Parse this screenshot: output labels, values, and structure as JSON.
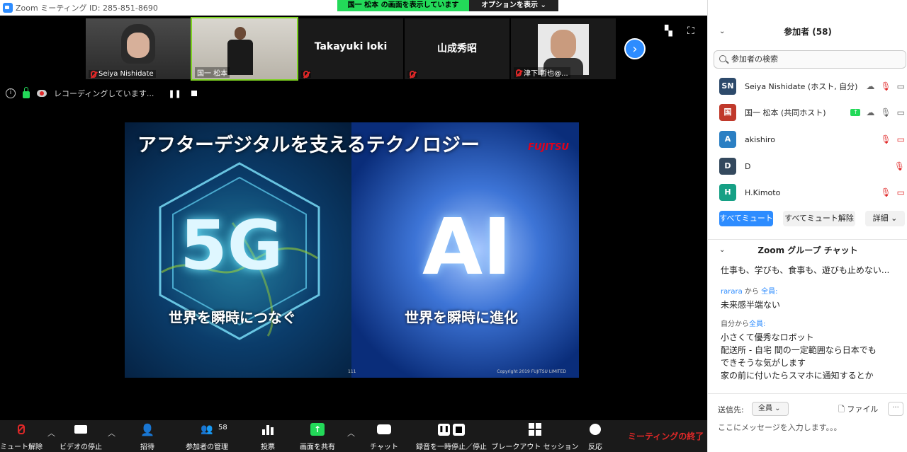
{
  "window": {
    "title": "Zoom ミーティング ID: 285-851-8690"
  },
  "share_banner": "国一 松本 の画面を表示しています",
  "options_button": "オプションを表示",
  "thumbnails": [
    {
      "name": "Seiya Nishidate",
      "video": true,
      "muted": true
    },
    {
      "name": "国一 松本",
      "video": true,
      "muted": false,
      "active": true
    },
    {
      "name": "Takayuki Ioki",
      "video": false,
      "muted": true
    },
    {
      "name": "山成秀昭",
      "video": false,
      "muted": true
    },
    {
      "name": "津下 哲也@...",
      "video": true,
      "muted": true
    }
  ],
  "status": {
    "recording_text": "レコーディングしています..."
  },
  "slide": {
    "title": "アフターデジタルを支えるテクノロジー",
    "brand": "FUJITSU",
    "left_big": "5G",
    "right_big": "AI",
    "left_caption": "世界を瞬時につなぐ",
    "right_caption": "世界を瞬時に進化",
    "page": "111",
    "copyright": "Copyright 2019 FUJITSU LIMITED"
  },
  "toolbar": {
    "unmute": "ミュート解除",
    "stop_video": "ビデオの停止",
    "invite": "招待",
    "manage_participants": "参加者の管理",
    "participant_count": "58",
    "polls": "投票",
    "share_screen": "画面を共有",
    "chat": "チャット",
    "recording": "録音を一時停止／停止",
    "breakout": "ブレークアウト セッション",
    "reactions": "反応",
    "end_meeting": "ミーティングの終了"
  },
  "participants_panel": {
    "header": "参加者 (58)",
    "search_placeholder": "参加者の検索",
    "list": [
      {
        "initials": "SN",
        "name": "Seiya Nishidate (ホスト, 自分)",
        "color": "#2d4a6b"
      },
      {
        "initials": "国",
        "name": "国一 松本 (共同ホスト)",
        "color": "#c0392b"
      },
      {
        "initials": "A",
        "name": "akishiro",
        "color": "#2b7fc3"
      },
      {
        "initials": "D",
        "name": "D",
        "color": "#34495e"
      },
      {
        "initials": "H",
        "name": "H.Kimoto",
        "color": "#16a085"
      }
    ],
    "mute_all": "すべてミュート",
    "unmute_all": "すべてミュート解除",
    "details": "詳細"
  },
  "chat_panel": {
    "header": "Zoom グループ チャット",
    "messages": [
      {
        "text": "仕事も、学びも、食事も、遊びも止めない..."
      },
      {
        "from": "rarara",
        "sep": "から",
        "to": "全員:",
        "text": "未来感半端ない"
      },
      {
        "from": "自分",
        "sep": "から",
        "to": "全員:",
        "text": "小さくて優秀なロボット"
      },
      {
        "text": "配送所 - 自宅 間の一定範囲なら日本でも"
      },
      {
        "text": "できそうな気がします"
      },
      {
        "text": "家の前に付いたらスマホに通知するとか"
      }
    ],
    "send_to_label": "送信先:",
    "send_to_value": "全員",
    "file_label": "ファイル",
    "input_placeholder": "ここにメッセージを入力します。。。"
  }
}
